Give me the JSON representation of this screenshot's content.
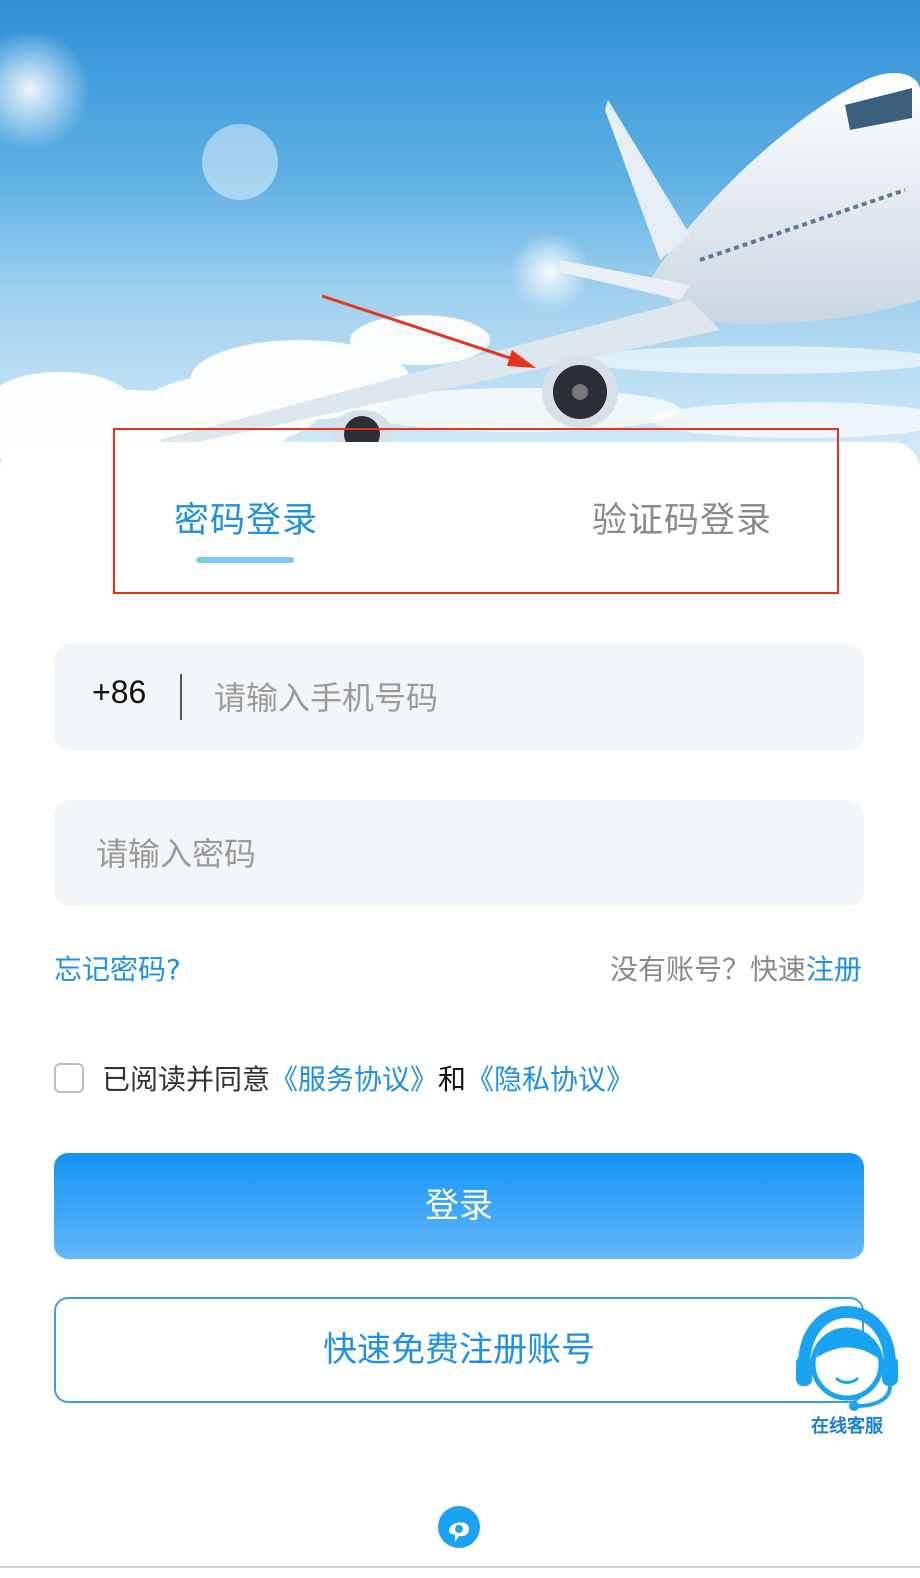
{
  "hero": {
    "image": "airplane-over-clouds",
    "annotation_arrow_color": "#e8321e"
  },
  "tabs": {
    "password_login": "密码登录",
    "code_login": "验证码登录",
    "active": "password_login"
  },
  "form": {
    "country_code": "+86",
    "phone_placeholder": "请输入手机号码",
    "password_placeholder": "请输入密码"
  },
  "links": {
    "forgot_password": "忘记密码?",
    "no_account": "没有账号？快速",
    "register": "注册"
  },
  "agreement": {
    "prefix": "已阅读并同意",
    "service": "《服务协议》",
    "and": "和",
    "privacy": "《隐私协议》",
    "checked": false
  },
  "buttons": {
    "login": "登录",
    "quick_register": "快速免费注册账号"
  },
  "support": {
    "label": "在线客服",
    "icon": "headset-agent-icon"
  },
  "colors": {
    "accent": "#1e90e8",
    "highlight_box": "#e8321e"
  }
}
